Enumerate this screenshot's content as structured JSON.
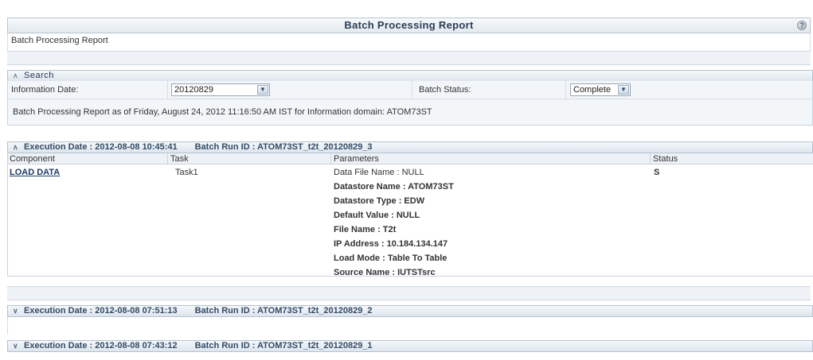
{
  "header": {
    "title": "Batch Processing Report",
    "subtitle": "Batch Processing Report"
  },
  "search": {
    "section_label": "Search",
    "info_date_label": "Information Date:",
    "info_date_value": "20120829",
    "batch_status_label": "Batch Status:",
    "batch_status_value": "Complete",
    "as_of_text": "Batch Processing Report as of Friday, August 24, 2012 11:16:50 AM IST for Information domain: ATOM73ST"
  },
  "executions": [
    {
      "exec_label": "Execution Date : 2012-08-08 10:45:41",
      "run_label": "Batch Run ID : ATOM73ST_t2t_20120829_3",
      "expanded": true
    },
    {
      "exec_label": "Execution Date : 2012-08-08 07:51:13",
      "run_label": "Batch Run ID : ATOM73ST_t2t_20120829_2",
      "expanded": false
    },
    {
      "exec_label": "Execution Date : 2012-08-08 07:43:12",
      "run_label": "Batch Run ID : ATOM73ST_t2t_20120829_1",
      "expanded": false
    }
  ],
  "table": {
    "columns": [
      "Component",
      "Task",
      "Parameters",
      "Status"
    ],
    "row": {
      "component": "LOAD DATA",
      "task": "Task1",
      "status": "S",
      "parameters": [
        "Data File Name : NULL",
        "Datastore Name : ATOM73ST",
        "Datastore Type : EDW",
        "Default Value : NULL",
        "File Name : T2t",
        "IP Address : 10.184.134.147",
        "Load Mode : Table To Table",
        "Source Name : IUTSTsrc"
      ]
    }
  }
}
